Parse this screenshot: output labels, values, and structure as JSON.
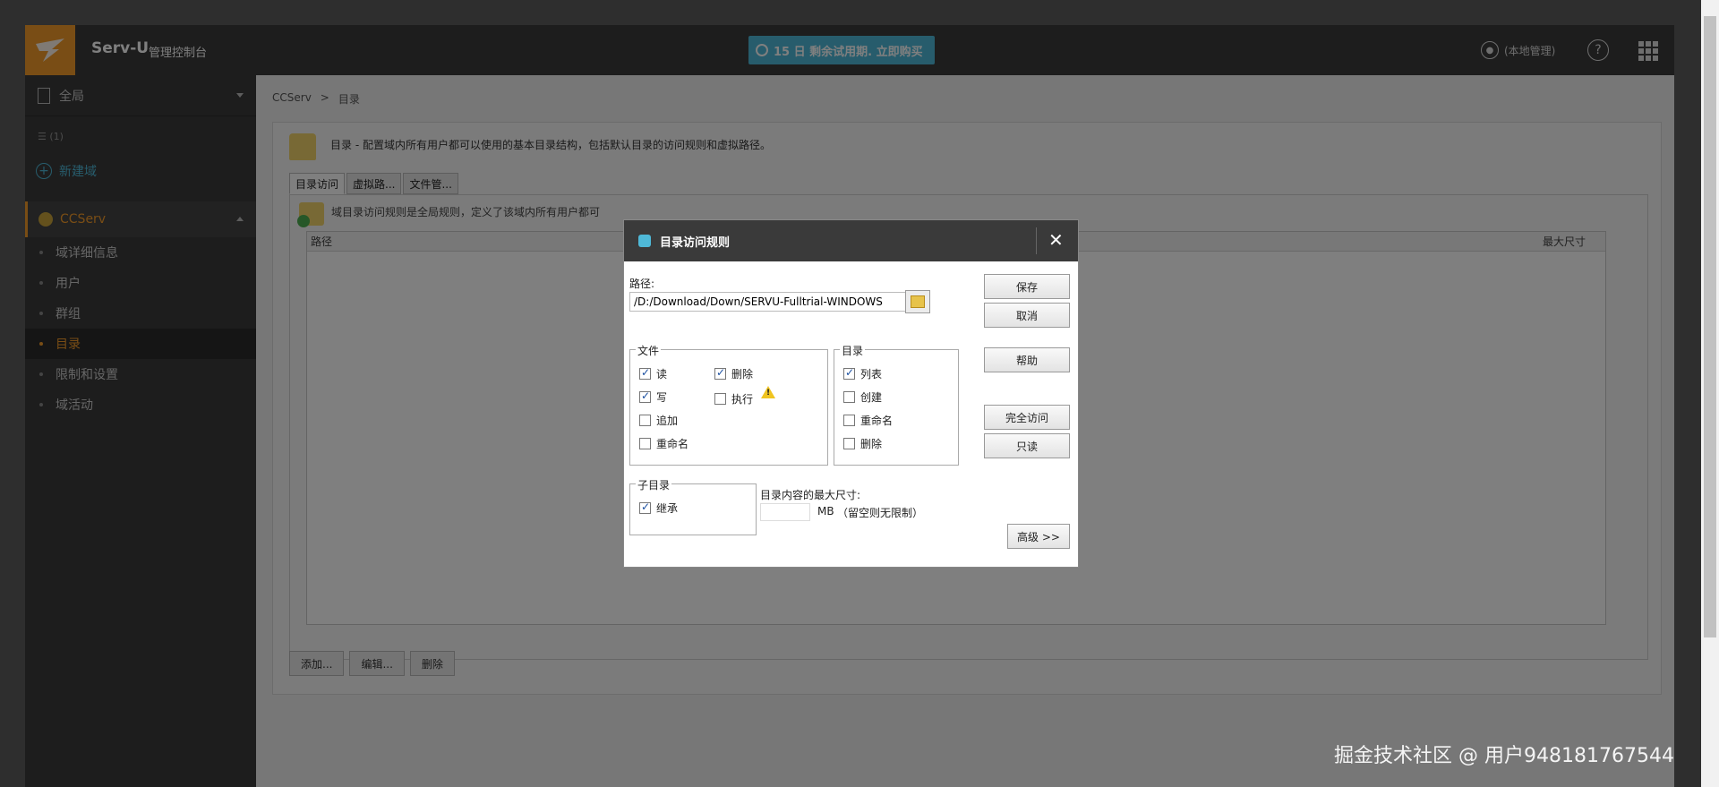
{
  "topbar": {
    "app_title": "Serv-U",
    "app_subtitle": "管理控制台",
    "trial_banner": "15 日 剩余试用期. 立即购买",
    "user_label": "(本地管理)",
    "help_glyph": "?"
  },
  "sidebar": {
    "global_label": "全局",
    "server_label": "☰ (1)",
    "new_domain_label": "新建域",
    "domain_name": "CCServ",
    "items": [
      {
        "label": "域详细信息",
        "active": false
      },
      {
        "label": "用户",
        "active": false
      },
      {
        "label": "群组",
        "active": false
      },
      {
        "label": "目录",
        "active": true
      },
      {
        "label": "限制和设置",
        "active": false
      },
      {
        "label": "域活动",
        "active": false
      }
    ]
  },
  "breadcrumb": {
    "domain": "CCServ",
    "separator": ">",
    "current": "目录"
  },
  "panel": {
    "description": "目录 - 配置域内所有用户都可以使用的基本目录结构，包括默认目录的访问规则和虚拟路径。",
    "tabs": [
      "目录访问",
      "虚拟路...",
      "文件管..."
    ],
    "inner_description": "域目录访问规则是全局规则，定义了该域内所有用户都可",
    "table_headers": {
      "path": "路径",
      "max_size": "最大尺寸"
    },
    "actions": [
      "添加...",
      "编辑...",
      "删除"
    ]
  },
  "dialog": {
    "title": "目录访问规则",
    "close_glyph": "✕",
    "path_label": "路径:",
    "path_value": "/D:/Download/Down/SERVU-Fulltrial-WINDOWS",
    "buttons": {
      "save": "保存",
      "cancel": "取消",
      "help": "帮助",
      "full_access": "完全访问",
      "read_only": "只读",
      "advanced": "高级 >>"
    },
    "files_group": {
      "legend": "文件",
      "read": {
        "label": "读",
        "checked": true
      },
      "write": {
        "label": "写",
        "checked": true
      },
      "append": {
        "label": "追加",
        "checked": false
      },
      "rename": {
        "label": "重命名",
        "checked": false
      },
      "delete": {
        "label": "删除",
        "checked": true
      },
      "execute": {
        "label": "执行",
        "checked": false
      }
    },
    "dirs_group": {
      "legend": "目录",
      "list": {
        "label": "列表",
        "checked": true
      },
      "create": {
        "label": "创建",
        "checked": false
      },
      "rename": {
        "label": "重命名",
        "checked": false
      },
      "delete": {
        "label": "删除",
        "checked": false
      }
    },
    "subdir_group": {
      "legend": "子目录",
      "inherit": {
        "label": "继承",
        "checked": true
      }
    },
    "max_size": {
      "label": "目录内容的最大尺寸:",
      "unit": "MB",
      "hint": "（留空则无限制）",
      "value": ""
    }
  },
  "watermark": "掘金技术社区 @ 用户948181767544",
  "colors": {
    "accent_orange": "#f39b2a",
    "trial_blue": "#4fb9d8",
    "topbar": "#3b3b3b"
  }
}
